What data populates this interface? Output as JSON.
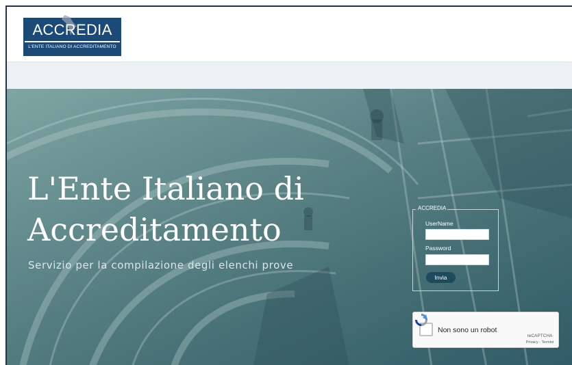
{
  "logo": {
    "name": "ACCREDIA",
    "subtitle": "L'ENTE ITALIANO DI ACCREDITAMENTO"
  },
  "hero": {
    "title_line1": "L'Ente Italiano di",
    "title_line2": "Accreditamento",
    "subtitle": "Servizio per la compilazione degli elenchi prove"
  },
  "login": {
    "legend": "ACCREDIA",
    "username_label": "UserName",
    "username_value": "",
    "password_label": "Password",
    "password_value": "",
    "submit_label": "Invia"
  },
  "recaptcha": {
    "label": "Non sono un robot",
    "brand": "reCAPTCHA",
    "privacy": "Privacy",
    "separator": " - ",
    "terms": "Termini"
  },
  "colors": {
    "brand_blue": "#1b4a78",
    "hero_teal": "#4f7b7f",
    "button": "#1d4a5c",
    "frame": "#1f3350"
  }
}
